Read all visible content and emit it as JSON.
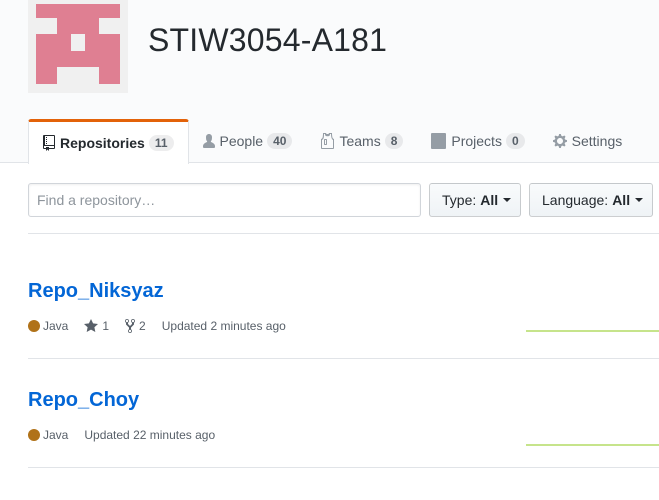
{
  "org": {
    "name": "STIW3054-A181"
  },
  "tabs": [
    {
      "label": "Repositories",
      "count": "11",
      "icon": "repo-icon"
    },
    {
      "label": "People",
      "count": "40",
      "icon": "person-icon"
    },
    {
      "label": "Teams",
      "count": "8",
      "icon": "jersey-icon"
    },
    {
      "label": "Projects",
      "count": "0",
      "icon": "project-icon"
    },
    {
      "label": "Settings",
      "icon": "gear-icon"
    }
  ],
  "filters": {
    "search_placeholder": "Find a repository…",
    "type_label": "Type:",
    "type_value": "All",
    "language_label": "Language:",
    "language_value": "All"
  },
  "repos": [
    {
      "name": "Repo_Niksyaz",
      "language": "Java",
      "stars": "1",
      "forks": "2",
      "updated": "Updated 2 minutes ago"
    },
    {
      "name": "Repo_Choy",
      "language": "Java",
      "updated": "Updated 22 minutes ago"
    }
  ],
  "colors": {
    "java": "#b07219",
    "accent": "#e36209",
    "link": "#0366d6",
    "avatar": "#df7f92"
  }
}
